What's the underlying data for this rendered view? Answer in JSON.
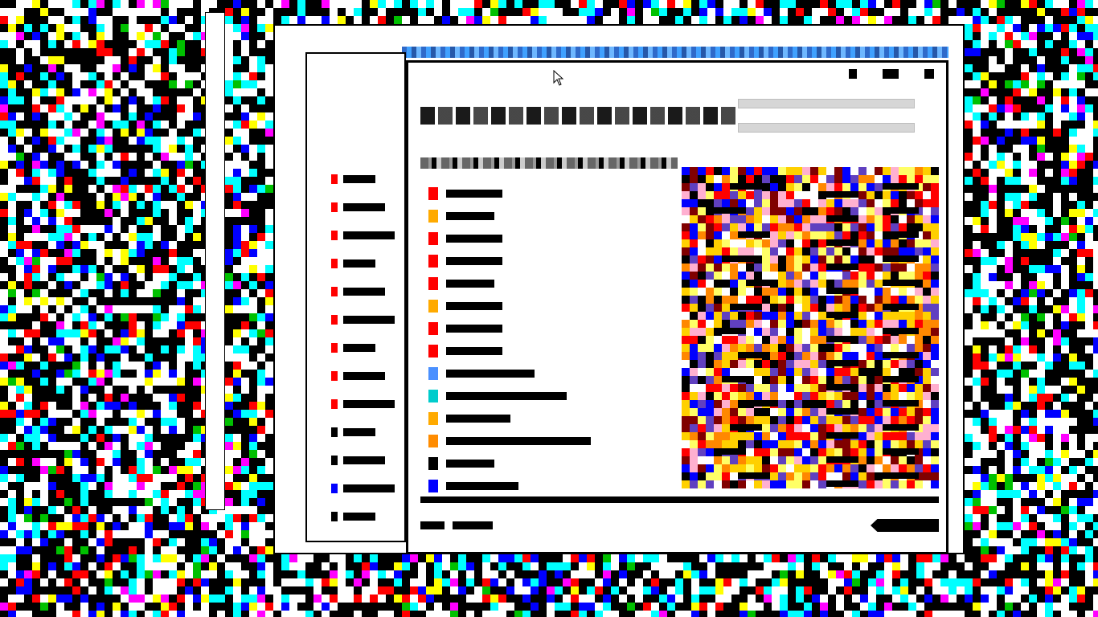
{
  "screen": {
    "description": "",
    "colors": {
      "background": "#000000",
      "window": "#ffffff",
      "noise_palette": [
        "#000000",
        "#ffffff",
        "#00ffff",
        "#0000ff",
        "#ff0000",
        "#ffff00",
        "#ff00ff",
        "#00c000"
      ]
    }
  },
  "main_window": {
    "title": "",
    "icons": {
      "minimize": "minimize-icon",
      "maximize": "maximize-icon",
      "close": "close-icon"
    },
    "address_bar": {
      "value": ""
    },
    "search_bar": {
      "value": ""
    },
    "file_list": {
      "rows": [
        {
          "icon_color": "#ff0000"
        },
        {
          "icon_color": "#ffaa00"
        },
        {
          "icon_color": "#ff0000"
        },
        {
          "icon_color": "#ff0000"
        },
        {
          "icon_color": "#ff0000"
        },
        {
          "icon_color": "#ffaa00"
        },
        {
          "icon_color": "#ff0000"
        },
        {
          "icon_color": "#ff0000"
        },
        {
          "icon_color": "#4a90ff"
        },
        {
          "icon_color": "#00cccc"
        },
        {
          "icon_color": "#ffaa00"
        },
        {
          "icon_color": "#ff8c00"
        },
        {
          "icon_color": "#000000"
        },
        {
          "icon_color": "#0000ff"
        }
      ]
    },
    "status": {
      "left": "",
      "right": ""
    }
  },
  "side_window": {
    "items": [
      {
        "icon_color": "#ff0000"
      },
      {
        "icon_color": "#ff0000"
      },
      {
        "icon_color": "#ff0000"
      },
      {
        "icon_color": "#ff0000"
      },
      {
        "icon_color": "#ff0000"
      },
      {
        "icon_color": "#ff0000"
      },
      {
        "icon_color": "#ff0000"
      },
      {
        "icon_color": "#ff0000"
      },
      {
        "icon_color": "#ff0000"
      },
      {
        "icon_color": "#000000"
      },
      {
        "icon_color": "#000000"
      },
      {
        "icon_color": "#0000ff"
      },
      {
        "icon_color": "#000000"
      }
    ]
  },
  "cursor": {
    "icon": "arrow-pointer-icon"
  }
}
